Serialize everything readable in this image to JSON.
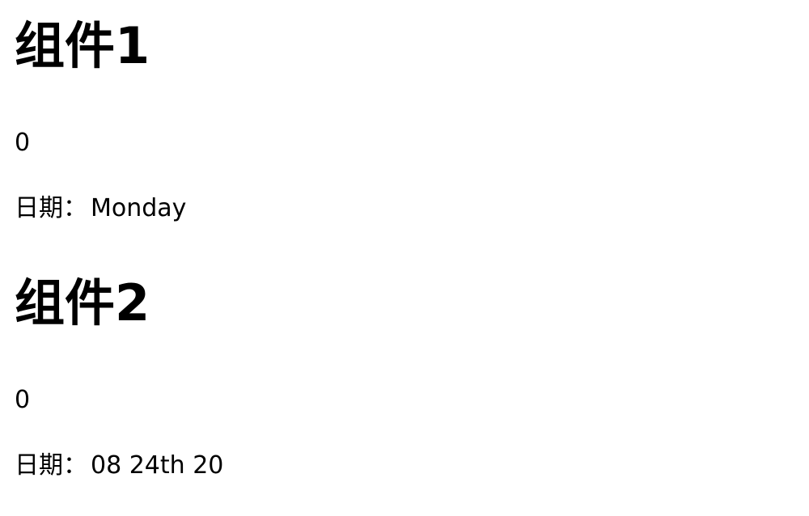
{
  "component1": {
    "title": "组件1",
    "count": "0",
    "date_label": "日期：",
    "date_value": "Monday"
  },
  "component2": {
    "title": "组件2",
    "count": "0",
    "date_label": "日期：",
    "date_value": "08 24th 20"
  }
}
